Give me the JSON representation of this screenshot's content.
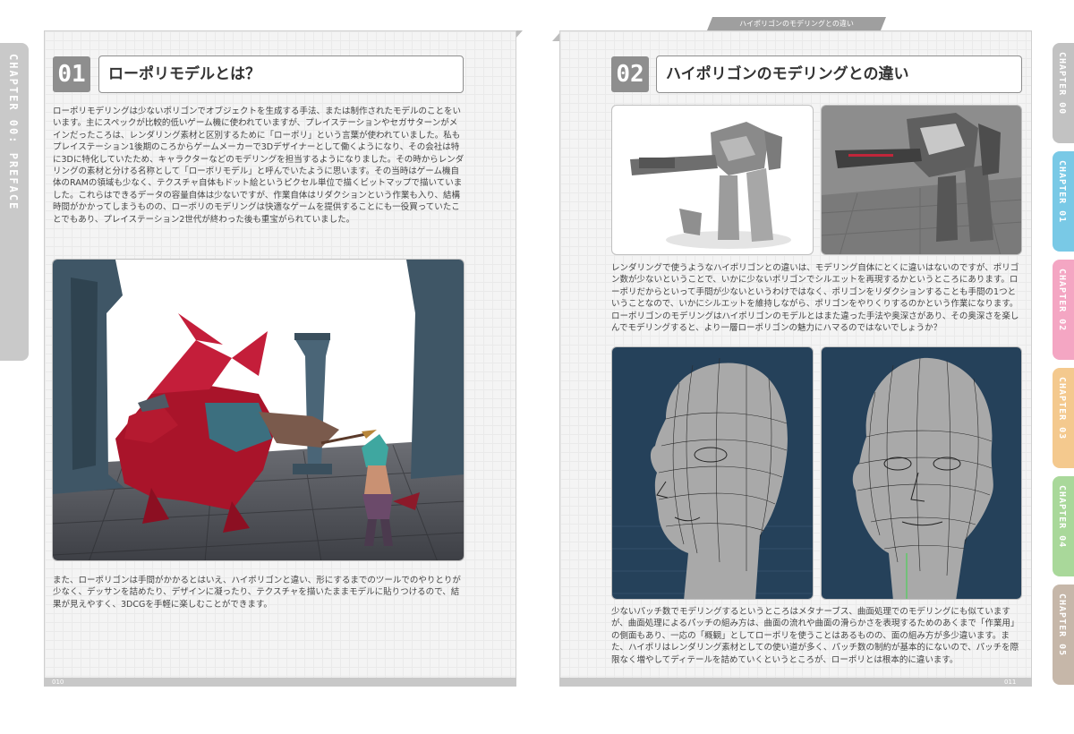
{
  "running_head": "ハイポリゴンのモデリングとの違い",
  "left_tab": "CHAPTER 00: PREFACE",
  "chapter_tabs": [
    {
      "label": "CHAPTER 00",
      "color": "#c2c2c2"
    },
    {
      "label": "CHAPTER 01",
      "color": "#79c9e6"
    },
    {
      "label": "CHAPTER 02",
      "color": "#f4a6c3"
    },
    {
      "label": "CHAPTER 03",
      "color": "#f4c98e"
    },
    {
      "label": "CHAPTER 04",
      "color": "#a9d89a"
    },
    {
      "label": "CHAPTER 05",
      "color": "#c6b7a9"
    }
  ],
  "left_page": {
    "section_number": "01",
    "section_title": "ローポリモデルとは？",
    "paragraph1": "ローポリモデリングは少ないポリゴンでオブジェクトを生成する手法、または制作されたモデルのことをいいます。主にスペックが比較的低いゲーム機に使われていますが、プレイステーションやセガサターンがメインだったころは、レンダリング素材と区別するために「ローポリ」という言葉が使われていました。私もプレイステーション1後期のころからゲームメーカーで3Dデザイナーとして働くようになり、その会社は特に3Dに特化していたため、キャラクターなどのモデリングを担当するようになりました。その時からレンダリングの素材と分ける名称として「ローポリモデル」と呼んでいたように思います。その当時はゲーム機自体のRAMの領域も少なく、テクスチャ自体もドット絵というピクセル単位で描くビットマップで描いていました。これらはできるデータの容量自体は少ないですが、作業自体はリダクションという作業も入り、結構時間がかかってしまうものの、ローポリのモデリングは快適なゲームを提供することにも一役買っていたことでもあり、プレイステーション2世代が終わった後も重宝がられていました。",
    "paragraph2": "また、ローポリゴンは手間がかかるとはいえ、ハイポリゴンと違い、形にするまでのツールでのやりとりが少なく、デッサンを詰めたり、デザインに凝ったり、テクスチャを描いたままモデルに貼りつけるので、結果が見えやすく、3DCGを手軽に楽しむことができます。",
    "page_number": "010"
  },
  "right_page": {
    "section_number": "02",
    "section_title": "ハイポリゴンのモデリングとの違い",
    "paragraph1": "レンダリングで使うようなハイポリゴンとの違いは、モデリング自体にとくに違いはないのですが、ポリゴン数が少ないということで、いかに少ないポリゴンでシルエットを再現するかというところにあります。ローポリだからといって手間が少ないというわけではなく、ポリゴンをリダクションすることも手間の1つということなので、いかにシルエットを維持しながら、ポリゴンをやりくりするのかという作業になります。ローポリゴンのモデリングはハイポリゴンのモデルとはまた違った手法や奥深さがあり、その奥深さを楽しんでモデリングすると、より一層ローポリゴンの魅力にハマるのではないでしょうか？",
    "paragraph2": "少ないパッチ数でモデリングするというところはメタナーブス、曲面処理でのモデリングにも似ていますが、曲面処理によるパッチの組み方は、曲面の流れや曲面の滑らかさを表現するためのあくまで「作業用」の側面もあり、一応の「概観」としてローポリを使うことはあるものの、面の組み方が多少違います。また、ハイポリはレンダリング素材としての使い道が多く、パッチ数の制約が基本的にないので、パッチを際限なく増やしてディテールを詰めていくというところが、ローポリとは根本的に違います。",
    "page_number": "011"
  }
}
